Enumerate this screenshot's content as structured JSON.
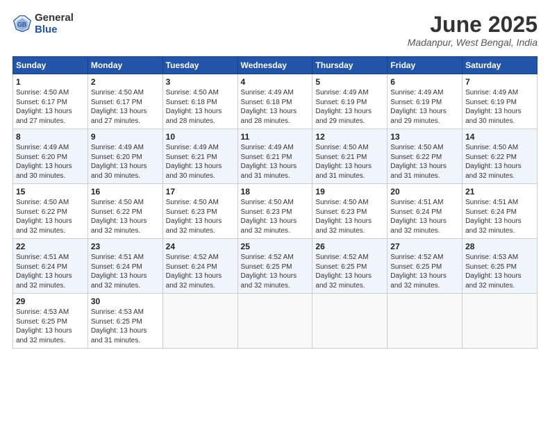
{
  "logo": {
    "general": "General",
    "blue": "Blue"
  },
  "title": "June 2025",
  "location": "Madanpur, West Bengal, India",
  "days_of_week": [
    "Sunday",
    "Monday",
    "Tuesday",
    "Wednesday",
    "Thursday",
    "Friday",
    "Saturday"
  ],
  "weeks": [
    [
      {
        "day": "1",
        "info": "Sunrise: 4:50 AM\nSunset: 6:17 PM\nDaylight: 13 hours\nand 27 minutes."
      },
      {
        "day": "2",
        "info": "Sunrise: 4:50 AM\nSunset: 6:17 PM\nDaylight: 13 hours\nand 27 minutes."
      },
      {
        "day": "3",
        "info": "Sunrise: 4:50 AM\nSunset: 6:18 PM\nDaylight: 13 hours\nand 28 minutes."
      },
      {
        "day": "4",
        "info": "Sunrise: 4:49 AM\nSunset: 6:18 PM\nDaylight: 13 hours\nand 28 minutes."
      },
      {
        "day": "5",
        "info": "Sunrise: 4:49 AM\nSunset: 6:19 PM\nDaylight: 13 hours\nand 29 minutes."
      },
      {
        "day": "6",
        "info": "Sunrise: 4:49 AM\nSunset: 6:19 PM\nDaylight: 13 hours\nand 29 minutes."
      },
      {
        "day": "7",
        "info": "Sunrise: 4:49 AM\nSunset: 6:19 PM\nDaylight: 13 hours\nand 30 minutes."
      }
    ],
    [
      {
        "day": "8",
        "info": "Sunrise: 4:49 AM\nSunset: 6:20 PM\nDaylight: 13 hours\nand 30 minutes."
      },
      {
        "day": "9",
        "info": "Sunrise: 4:49 AM\nSunset: 6:20 PM\nDaylight: 13 hours\nand 30 minutes."
      },
      {
        "day": "10",
        "info": "Sunrise: 4:49 AM\nSunset: 6:21 PM\nDaylight: 13 hours\nand 30 minutes."
      },
      {
        "day": "11",
        "info": "Sunrise: 4:49 AM\nSunset: 6:21 PM\nDaylight: 13 hours\nand 31 minutes."
      },
      {
        "day": "12",
        "info": "Sunrise: 4:50 AM\nSunset: 6:21 PM\nDaylight: 13 hours\nand 31 minutes."
      },
      {
        "day": "13",
        "info": "Sunrise: 4:50 AM\nSunset: 6:22 PM\nDaylight: 13 hours\nand 31 minutes."
      },
      {
        "day": "14",
        "info": "Sunrise: 4:50 AM\nSunset: 6:22 PM\nDaylight: 13 hours\nand 32 minutes."
      }
    ],
    [
      {
        "day": "15",
        "info": "Sunrise: 4:50 AM\nSunset: 6:22 PM\nDaylight: 13 hours\nand 32 minutes."
      },
      {
        "day": "16",
        "info": "Sunrise: 4:50 AM\nSunset: 6:22 PM\nDaylight: 13 hours\nand 32 minutes."
      },
      {
        "day": "17",
        "info": "Sunrise: 4:50 AM\nSunset: 6:23 PM\nDaylight: 13 hours\nand 32 minutes."
      },
      {
        "day": "18",
        "info": "Sunrise: 4:50 AM\nSunset: 6:23 PM\nDaylight: 13 hours\nand 32 minutes."
      },
      {
        "day": "19",
        "info": "Sunrise: 4:50 AM\nSunset: 6:23 PM\nDaylight: 13 hours\nand 32 minutes."
      },
      {
        "day": "20",
        "info": "Sunrise: 4:51 AM\nSunset: 6:24 PM\nDaylight: 13 hours\nand 32 minutes."
      },
      {
        "day": "21",
        "info": "Sunrise: 4:51 AM\nSunset: 6:24 PM\nDaylight: 13 hours\nand 32 minutes."
      }
    ],
    [
      {
        "day": "22",
        "info": "Sunrise: 4:51 AM\nSunset: 6:24 PM\nDaylight: 13 hours\nand 32 minutes."
      },
      {
        "day": "23",
        "info": "Sunrise: 4:51 AM\nSunset: 6:24 PM\nDaylight: 13 hours\nand 32 minutes."
      },
      {
        "day": "24",
        "info": "Sunrise: 4:52 AM\nSunset: 6:24 PM\nDaylight: 13 hours\nand 32 minutes."
      },
      {
        "day": "25",
        "info": "Sunrise: 4:52 AM\nSunset: 6:25 PM\nDaylight: 13 hours\nand 32 minutes."
      },
      {
        "day": "26",
        "info": "Sunrise: 4:52 AM\nSunset: 6:25 PM\nDaylight: 13 hours\nand 32 minutes."
      },
      {
        "day": "27",
        "info": "Sunrise: 4:52 AM\nSunset: 6:25 PM\nDaylight: 13 hours\nand 32 minutes."
      },
      {
        "day": "28",
        "info": "Sunrise: 4:53 AM\nSunset: 6:25 PM\nDaylight: 13 hours\nand 32 minutes."
      }
    ],
    [
      {
        "day": "29",
        "info": "Sunrise: 4:53 AM\nSunset: 6:25 PM\nDaylight: 13 hours\nand 32 minutes."
      },
      {
        "day": "30",
        "info": "Sunrise: 4:53 AM\nSunset: 6:25 PM\nDaylight: 13 hours\nand 31 minutes."
      },
      {
        "day": "",
        "info": ""
      },
      {
        "day": "",
        "info": ""
      },
      {
        "day": "",
        "info": ""
      },
      {
        "day": "",
        "info": ""
      },
      {
        "day": "",
        "info": ""
      }
    ]
  ]
}
